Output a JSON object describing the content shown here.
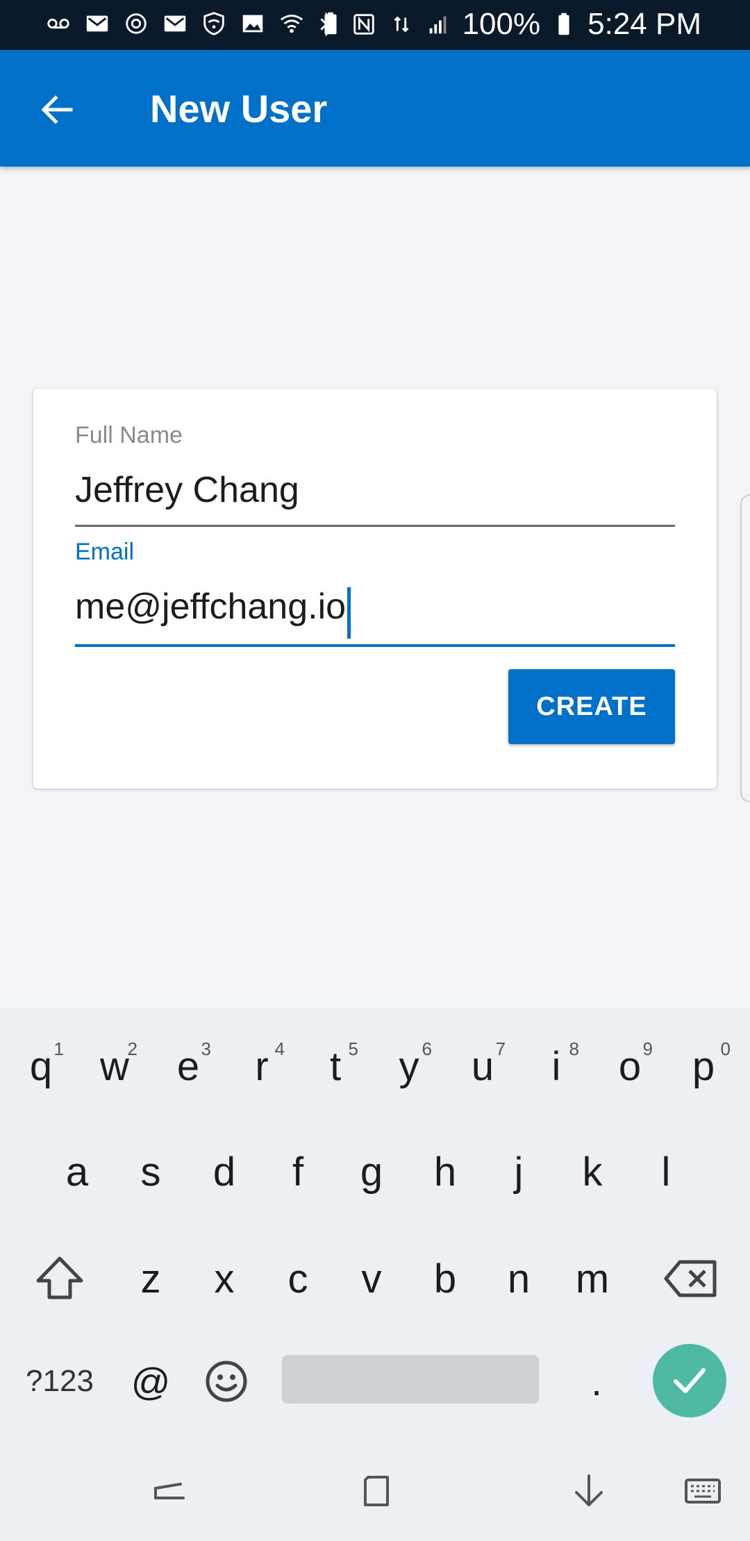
{
  "status_bar": {
    "battery_percent": "100%",
    "time": "5:24 PM",
    "icons": [
      "voicemail-icon",
      "gmail-icon",
      "sync-icon",
      "gmail-icon",
      "wifi-shield-icon",
      "image-icon",
      "wifi-icon",
      "battery-100-icon",
      "bluetooth-icon",
      "nfc-icon",
      "lte-icon",
      "signal-icon",
      "battery-icon"
    ],
    "battery_level": "100"
  },
  "app_bar": {
    "title": "New User",
    "back_icon": "arrow-back-icon"
  },
  "form": {
    "full_name_label": "Full Name",
    "full_name_value": "Jeffrey Chang",
    "email_label": "Email",
    "email_value": "me@jeffchang.io",
    "create_label": "CREATE"
  },
  "keyboard": {
    "row1": [
      {
        "key": "q",
        "hint": "1"
      },
      {
        "key": "w",
        "hint": "2"
      },
      {
        "key": "e",
        "hint": "3"
      },
      {
        "key": "r",
        "hint": "4"
      },
      {
        "key": "t",
        "hint": "5"
      },
      {
        "key": "y",
        "hint": "6"
      },
      {
        "key": "u",
        "hint": "7"
      },
      {
        "key": "i",
        "hint": "8"
      },
      {
        "key": "o",
        "hint": "9"
      },
      {
        "key": "p",
        "hint": "0"
      }
    ],
    "row2": [
      "a",
      "s",
      "d",
      "f",
      "g",
      "h",
      "j",
      "k",
      "l"
    ],
    "row3": [
      "z",
      "x",
      "c",
      "v",
      "b",
      "n",
      "m"
    ],
    "symbols_label": "?123",
    "at_label": "@",
    "period_label": "."
  },
  "colors": {
    "accent": "#0070c9",
    "status_bar": "#0b1a2a",
    "done_key": "#4fb9a4",
    "background": "#f2f4f7"
  }
}
